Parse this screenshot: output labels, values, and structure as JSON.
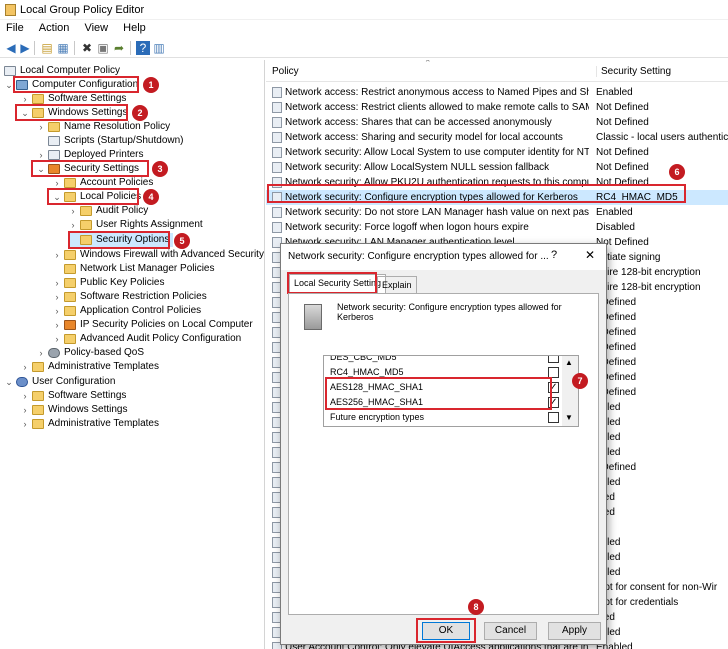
{
  "window": {
    "title": "Local Group Policy Editor"
  },
  "menu": [
    "File",
    "Action",
    "View",
    "Help"
  ],
  "toolbar_icons": [
    "back-icon",
    "forward-icon",
    "up-folder-icon",
    "show-hide-tree-icon",
    "delete-icon",
    "properties-icon",
    "export-icon",
    "help-icon",
    "view-icon"
  ],
  "tree": [
    {
      "label": "Local Computer Policy",
      "icon": "doc"
    },
    {
      "label": "Computer Configuration",
      "icon": "comp"
    },
    {
      "label": "Software Settings",
      "icon": "folder"
    },
    {
      "label": "Windows Settings",
      "icon": "folder"
    },
    {
      "label": "Name Resolution Policy",
      "icon": "folder"
    },
    {
      "label": "Scripts (Startup/Shutdown)",
      "icon": "doc"
    },
    {
      "label": "Deployed Printers",
      "icon": "doc"
    },
    {
      "label": "Security Settings",
      "icon": "shield"
    },
    {
      "label": "Account Policies",
      "icon": "folder"
    },
    {
      "label": "Local Policies",
      "icon": "folder"
    },
    {
      "label": "Audit Policy",
      "icon": "folder"
    },
    {
      "label": "User Rights Assignment",
      "icon": "folder"
    },
    {
      "label": "Security Options",
      "icon": "folder"
    },
    {
      "label": "Windows Firewall with Advanced Security",
      "icon": "folder"
    },
    {
      "label": "Network List Manager Policies",
      "icon": "folder"
    },
    {
      "label": "Public Key Policies",
      "icon": "folder"
    },
    {
      "label": "Software Restriction Policies",
      "icon": "folder"
    },
    {
      "label": "Application Control Policies",
      "icon": "folder"
    },
    {
      "label": "IP Security Policies on Local Computer",
      "icon": "shield"
    },
    {
      "label": "Advanced Audit Policy Configuration",
      "icon": "folder"
    },
    {
      "label": "Policy-based QoS",
      "icon": "gear"
    },
    {
      "label": "Administrative Templates",
      "icon": "folder"
    },
    {
      "label": "User Configuration",
      "icon": "user"
    },
    {
      "label": "Software Settings",
      "icon": "folder"
    },
    {
      "label": "Windows Settings",
      "icon": "folder"
    },
    {
      "label": "Administrative Templates",
      "icon": "folder"
    }
  ],
  "list": {
    "col_policy": "Policy",
    "col_setting": "Security Setting",
    "rows": [
      {
        "policy": "Network access: Restrict anonymous access to Named Pipes and Shares",
        "setting": "Enabled"
      },
      {
        "policy": "Network access: Restrict clients allowed to make remote calls to SAM",
        "setting": "Not Defined"
      },
      {
        "policy": "Network access: Shares that can be accessed anonymously",
        "setting": "Not Defined"
      },
      {
        "policy": "Network access: Sharing and security model for local accounts",
        "setting": "Classic - local users authenticate"
      },
      {
        "policy": "Network security: Allow Local System to use computer identity for NTLM",
        "setting": "Not Defined"
      },
      {
        "policy": "Network security: Allow LocalSystem NULL session fallback",
        "setting": "Not Defined"
      },
      {
        "policy": "Network security: Allow PKU2U authentication requests to this comput...",
        "setting": "Not Defined"
      },
      {
        "policy": "Network security: Configure encryption types allowed for Kerberos",
        "setting": "RC4_HMAC_MD5"
      },
      {
        "policy": "Network security: Do not store LAN Manager hash value on next passw...",
        "setting": "Enabled"
      },
      {
        "policy": "Network security: Force logoff when logon hours expire",
        "setting": "Disabled"
      },
      {
        "policy": "Network security: LAN Manager authentication level",
        "setting": "Not Defined"
      },
      {
        "policy": "",
        "setting": "gotiate signing"
      },
      {
        "policy": "",
        "setting": "quire 128-bit encryption"
      },
      {
        "policy": "",
        "setting": "quire 128-bit encryption"
      },
      {
        "policy": "",
        "setting": "t Defined"
      },
      {
        "policy": "",
        "setting": "t Defined"
      },
      {
        "policy": "",
        "setting": "t Defined"
      },
      {
        "policy": "",
        "setting": "t Defined"
      },
      {
        "policy": "",
        "setting": "t Defined"
      },
      {
        "policy": "",
        "setting": "t Defined"
      },
      {
        "policy": "",
        "setting": "t Defined"
      },
      {
        "policy": "",
        "setting": "abled"
      },
      {
        "policy": "",
        "setting": "abled"
      },
      {
        "policy": "",
        "setting": "abled"
      },
      {
        "policy": "",
        "setting": "abled"
      },
      {
        "policy": "",
        "setting": "t Defined"
      },
      {
        "policy": "",
        "setting": "abled"
      },
      {
        "policy": "",
        "setting": "bled"
      },
      {
        "policy": "",
        "setting": "bled"
      },
      {
        "policy": "",
        "setting": ""
      },
      {
        "policy": "",
        "setting": "abled"
      },
      {
        "policy": "",
        "setting": "abled"
      },
      {
        "policy": "",
        "setting": "abled"
      },
      {
        "policy": "",
        "setting": "mpt for consent for non-Wir"
      },
      {
        "policy": "",
        "setting": "mpt for credentials"
      },
      {
        "policy": "",
        "setting": "bled"
      },
      {
        "policy": "",
        "setting": "abled"
      },
      {
        "policy": "User Account Control: Only elevate UIAccess applications that are instal...",
        "setting": "Enabled"
      }
    ]
  },
  "dialog": {
    "title": "Network security: Configure encryption types allowed for ...",
    "help": "?",
    "close": "✕",
    "tabs": [
      "Local Security Setting",
      "Explain"
    ],
    "description": "Network security: Configure encryption types allowed for Kerberos",
    "options": [
      {
        "label": "DES_CBC_MD5",
        "mark": ""
      },
      {
        "label": "RC4_HMAC_MD5",
        "mark": ""
      },
      {
        "label": "AES128_HMAC_SHA1",
        "mark": "✓"
      },
      {
        "label": "AES256_HMAC_SHA1",
        "mark": "✓"
      },
      {
        "label": "Future encryption types",
        "mark": ""
      }
    ],
    "buttons": {
      "ok": "OK",
      "cancel": "Cancel",
      "apply": "Apply"
    }
  },
  "badges": [
    "1",
    "2",
    "3",
    "4",
    "5",
    "6",
    "7",
    "8"
  ],
  "accent": {
    "highlight": "#d9262e",
    "badge": "#c31b21",
    "selection": "#cce8ff"
  }
}
